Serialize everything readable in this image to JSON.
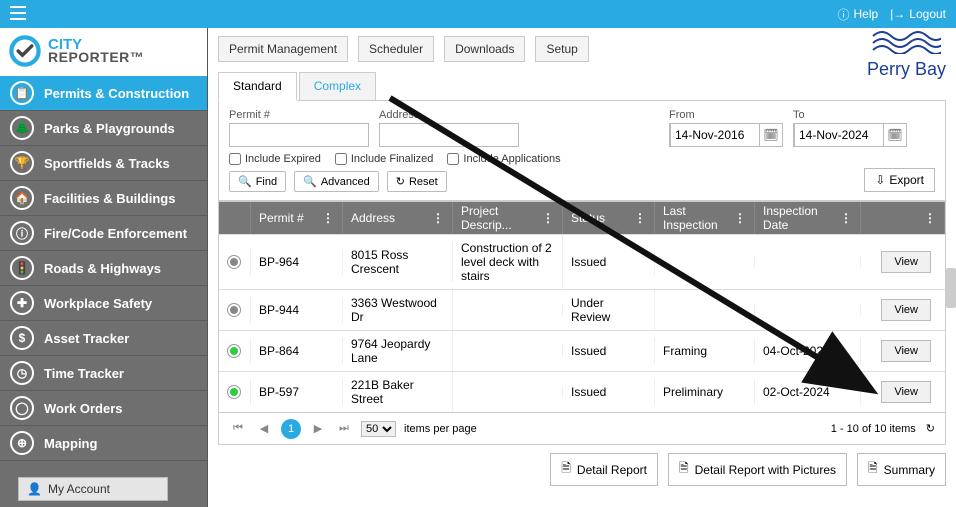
{
  "topbar": {
    "help": "Help",
    "logout": "Logout"
  },
  "logo": {
    "city": "CITY",
    "reporter": "REPORTER™"
  },
  "sidebar": {
    "items": [
      {
        "label": "Permits & Construction",
        "icon": "clipboard",
        "active": true
      },
      {
        "label": "Parks & Playgrounds",
        "icon": "tree"
      },
      {
        "label": "Sportfields & Tracks",
        "icon": "trophy"
      },
      {
        "label": "Facilities & Buildings",
        "icon": "building"
      },
      {
        "label": "Fire/Code Enforcement",
        "icon": "fire"
      },
      {
        "label": "Roads & Highways",
        "icon": "traffic"
      },
      {
        "label": "Workplace Safety",
        "icon": "safety"
      },
      {
        "label": "Asset Tracker",
        "icon": "money"
      },
      {
        "label": "Time Tracker",
        "icon": "clock"
      },
      {
        "label": "Work Orders",
        "icon": "orders"
      },
      {
        "label": "Mapping",
        "icon": "map"
      }
    ],
    "my_account": "My Account"
  },
  "brand": "Perry Bay",
  "top_actions": {
    "permit_mgmt": "Permit Management",
    "scheduler": "Scheduler",
    "downloads": "Downloads",
    "setup": "Setup"
  },
  "tabs": {
    "standard": "Standard",
    "complex": "Complex"
  },
  "filters": {
    "permit_label": "Permit #",
    "permit_val": "",
    "address_label": "Address",
    "address_val": "",
    "from_label": "From",
    "from_val": "14-Nov-2016",
    "to_label": "To",
    "to_val": "14-Nov-2024",
    "include_expired": "Include Expired",
    "include_finalized": "Include Finalized",
    "include_applications": "Include Applications",
    "find": "Find",
    "advanced": "Advanced",
    "reset": "Reset",
    "export": "Export"
  },
  "table": {
    "headers": {
      "permit": "Permit #",
      "address": "Address",
      "desc": "Project Descrip...",
      "status": "Status",
      "lastinsp": "Last Inspection",
      "inspdate": "Inspection Date"
    },
    "view_label": "View",
    "rows": [
      {
        "dot": "grey",
        "permit": "BP-964",
        "address": "8015 Ross Crescent",
        "desc": "Construction of 2 level deck with stairs",
        "status": "Issued",
        "lastinsp": "",
        "inspdate": ""
      },
      {
        "dot": "grey",
        "permit": "BP-944",
        "address": "3363 Westwood Dr",
        "desc": "",
        "status": "Under Review",
        "lastinsp": "",
        "inspdate": ""
      },
      {
        "dot": "green",
        "permit": "BP-864",
        "address": "9764 Jeopardy Lane",
        "desc": "",
        "status": "Issued",
        "lastinsp": "Framing",
        "inspdate": "04-Oct-2024"
      },
      {
        "dot": "green",
        "permit": "BP-597",
        "address": "221B Baker Street",
        "desc": "",
        "status": "Issued",
        "lastinsp": "Preliminary",
        "inspdate": "02-Oct-2024"
      }
    ]
  },
  "pager": {
    "page": "1",
    "page_size": "50",
    "items_per_page": "items per page",
    "summary": "1 - 10 of 10 items"
  },
  "reports": {
    "detail": "Detail Report",
    "detail_pics": "Detail Report with Pictures",
    "summary": "Summary"
  }
}
